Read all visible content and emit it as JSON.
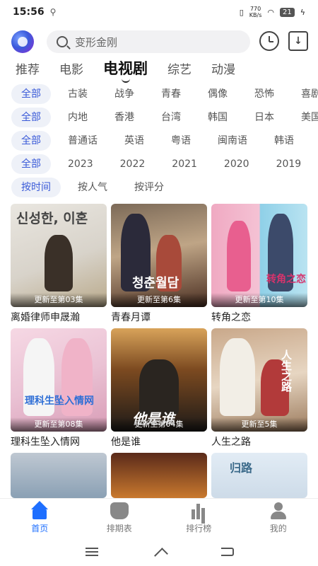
{
  "status": {
    "time": "15:56",
    "net_speed": "770",
    "net_unit": "KB/s",
    "battery": "21"
  },
  "search": {
    "placeholder": "变形金刚"
  },
  "tabs": [
    {
      "label": "推荐",
      "active": false
    },
    {
      "label": "电影",
      "active": false
    },
    {
      "label": "电视剧",
      "active": true
    },
    {
      "label": "综艺",
      "active": false
    },
    {
      "label": "动漫",
      "active": false
    }
  ],
  "filters": {
    "genre": [
      "全部",
      "古装",
      "战争",
      "青春",
      "偶像",
      "恐怖",
      "喜剧"
    ],
    "region": [
      "全部",
      "内地",
      "香港",
      "台湾",
      "韩国",
      "日本",
      "美国"
    ],
    "language": [
      "全部",
      "普通话",
      "英语",
      "粤语",
      "闽南语",
      "韩语"
    ],
    "year": [
      "全部",
      "2023",
      "2022",
      "2021",
      "2020",
      "2019"
    ],
    "sort": [
      "按时间",
      "按人气",
      "按评分"
    ]
  },
  "shows": [
    {
      "title": "离婚律师申晟瀚",
      "update": "更新至第03集"
    },
    {
      "title": "青春月谭",
      "update": "更新至第6集"
    },
    {
      "title": "转角之恋",
      "update": "更新至第10集"
    },
    {
      "title": "理科生坠入情网",
      "update": "更新至第08集"
    },
    {
      "title": "他是谁",
      "update": "更新至第04集"
    },
    {
      "title": "人生之路",
      "update": "更新至5集"
    },
    {
      "title": "",
      "update": ""
    },
    {
      "title": "",
      "update": ""
    },
    {
      "title": "",
      "update": ""
    }
  ],
  "poster_text": {
    "p1": "신성한, 이혼",
    "p2": "청춘월담",
    "p3": "转角之恋",
    "p4": "理科生坠入情网",
    "p5": "他是谁",
    "p6": "人生之路",
    "p9": "归路"
  },
  "bottom_nav": [
    {
      "label": "首页",
      "active": true
    },
    {
      "label": "排期表",
      "active": false
    },
    {
      "label": "排行榜",
      "active": false
    },
    {
      "label": "我的",
      "active": false
    }
  ]
}
